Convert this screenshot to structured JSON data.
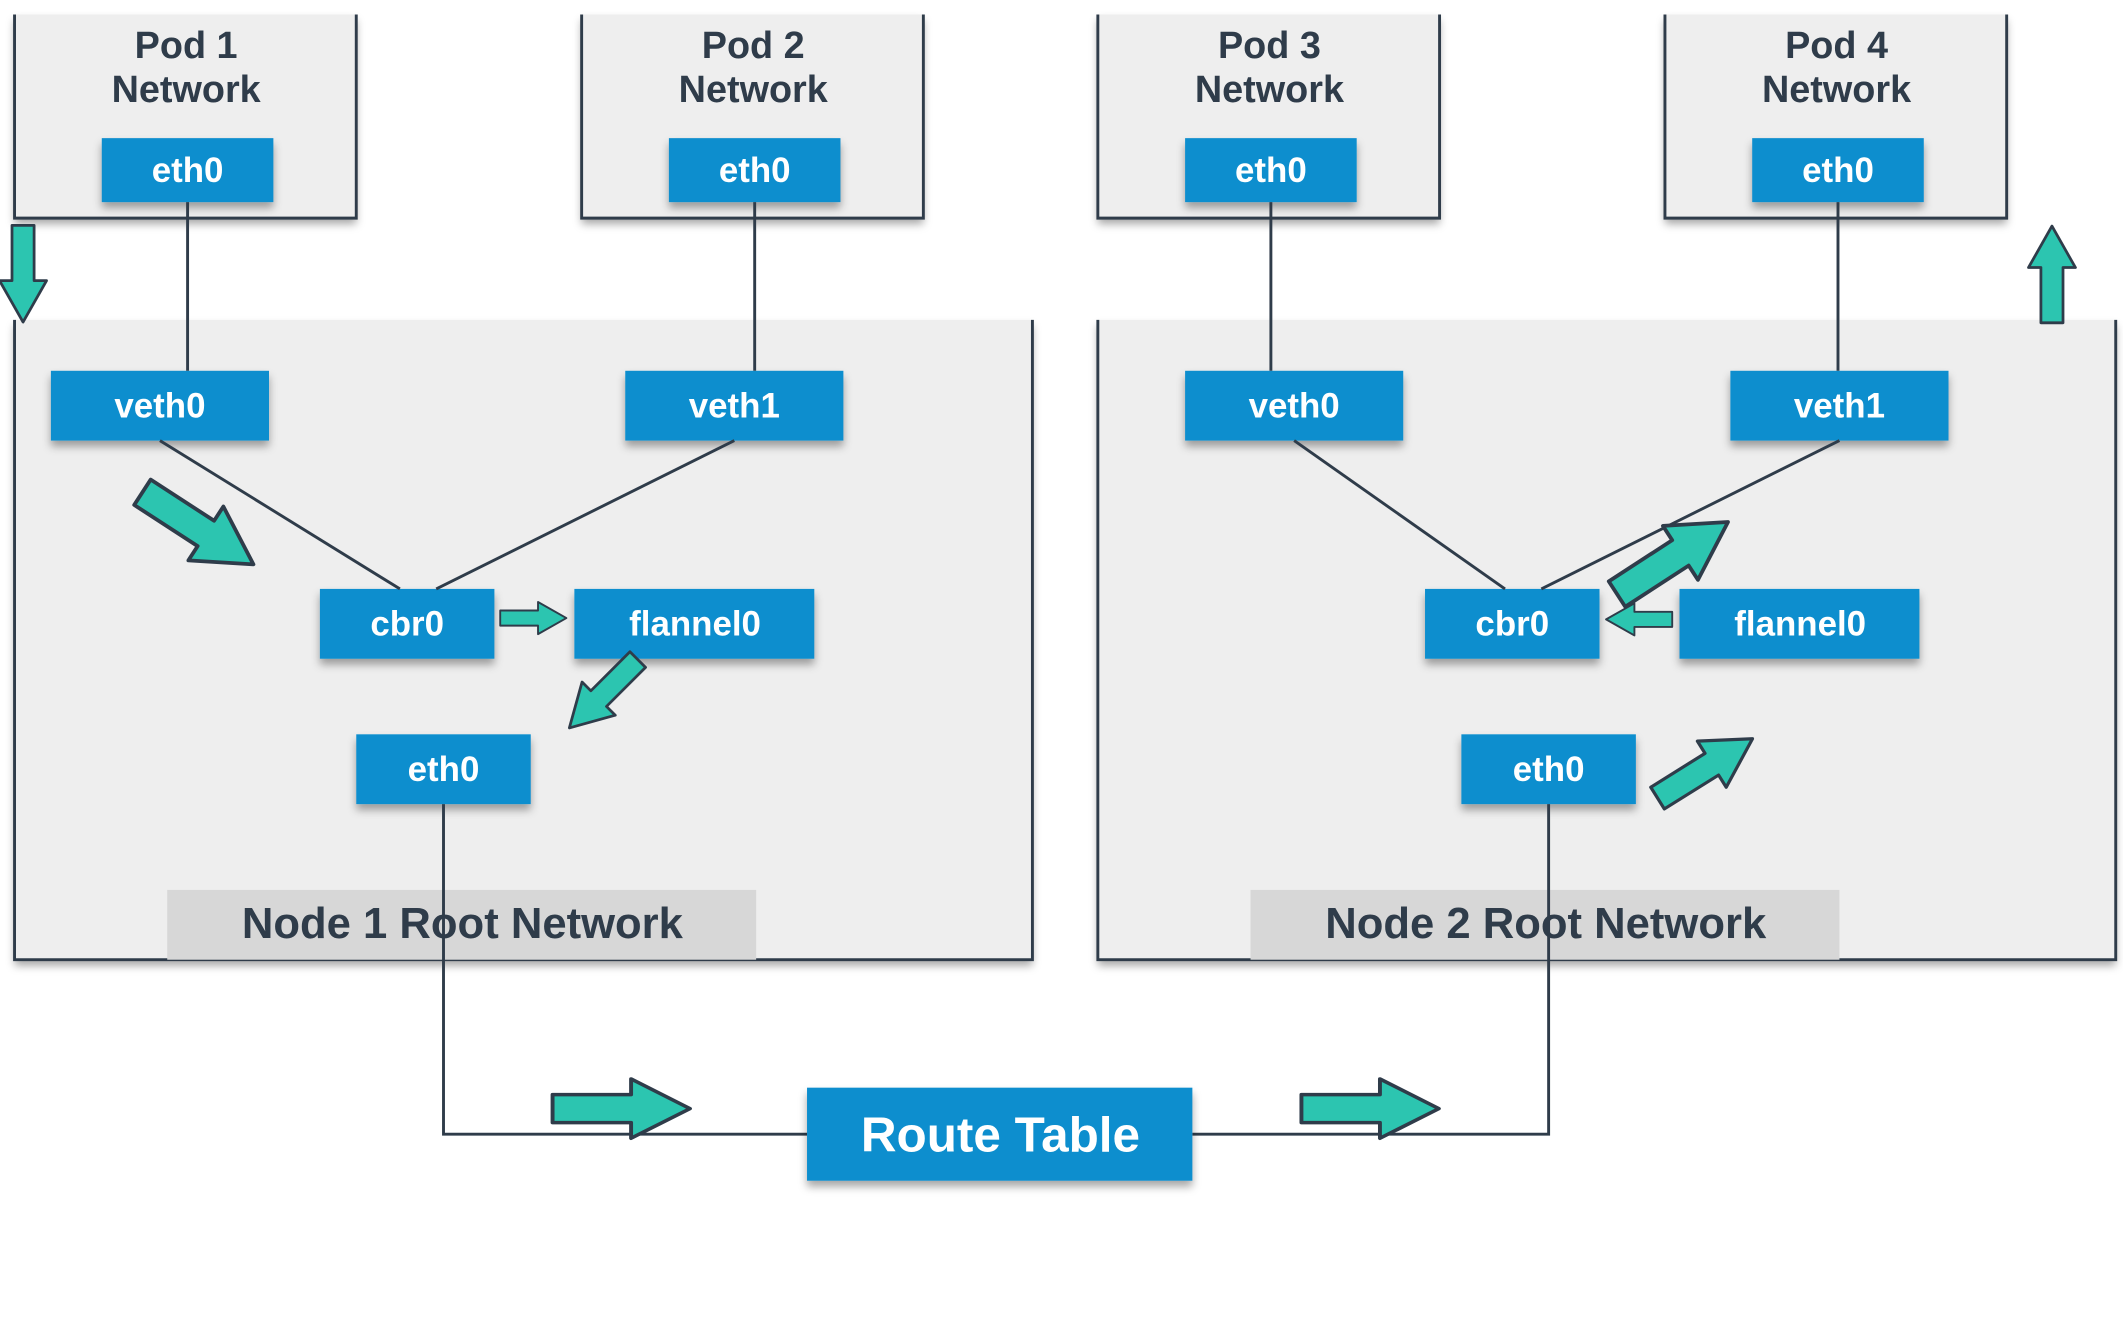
{
  "pods": {
    "p1_title1": "Pod 1",
    "p1_title2": "Network",
    "p2_title1": "Pod 2",
    "p2_title2": "Network",
    "p3_title1": "Pod 3",
    "p3_title2": "Network",
    "p4_title1": "Pod 4",
    "p4_title2": "Network",
    "eth0": "eth0"
  },
  "node1": {
    "veth0": "veth0",
    "veth1": "veth1",
    "cbr0": "cbr0",
    "flannel0": "flannel0",
    "eth0": "eth0",
    "banner": "Node 1 Root Network"
  },
  "node2": {
    "veth0": "veth0",
    "veth1": "veth1",
    "cbr0": "cbr0",
    "flannel0": "flannel0",
    "eth0": "eth0",
    "banner": "Node 2 Root Network"
  },
  "route_table": "Route Table",
  "colors": {
    "blue": "#0f8ece",
    "teal": "#2cc5b0",
    "panel": "#eeeeee",
    "banner": "#d7d7d7",
    "ink": "#2f3c4a"
  }
}
